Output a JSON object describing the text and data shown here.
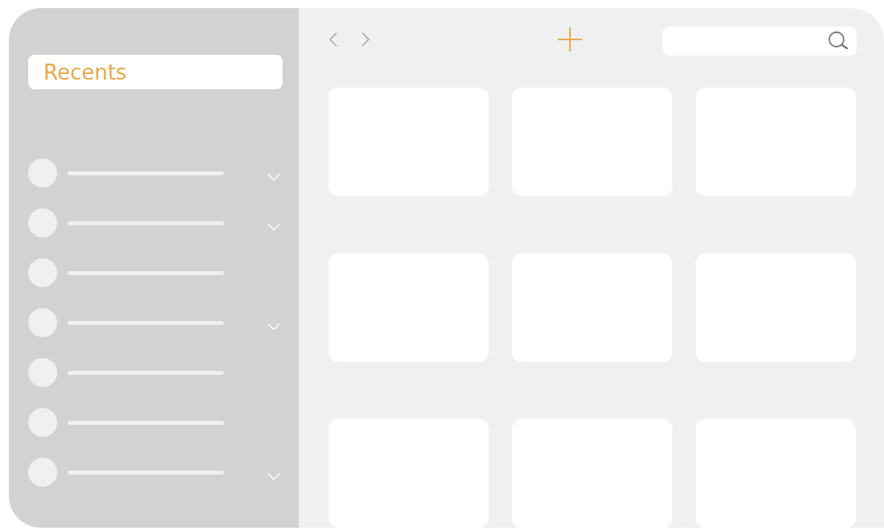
{
  "sidebar": {
    "title": {
      "label": "Recents",
      "selected": true
    },
    "items": [
      {
        "expandable": true
      },
      {
        "expandable": true
      },
      {
        "expandable": false
      },
      {
        "expandable": true
      },
      {
        "expandable": false
      },
      {
        "expandable": false
      },
      {
        "expandable": true
      }
    ]
  },
  "toolbar": {
    "search": {
      "kind": "field"
    }
  },
  "cards": [
    {
      "kind": "placeholder"
    },
    {
      "kind": "placeholder"
    },
    {
      "kind": "placeholder"
    },
    {
      "kind": "placeholder"
    },
    {
      "kind": "placeholder"
    },
    {
      "kind": "placeholder"
    },
    {
      "kind": "placeholder"
    },
    {
      "kind": "placeholder"
    },
    {
      "kind": "placeholder"
    }
  ]
}
